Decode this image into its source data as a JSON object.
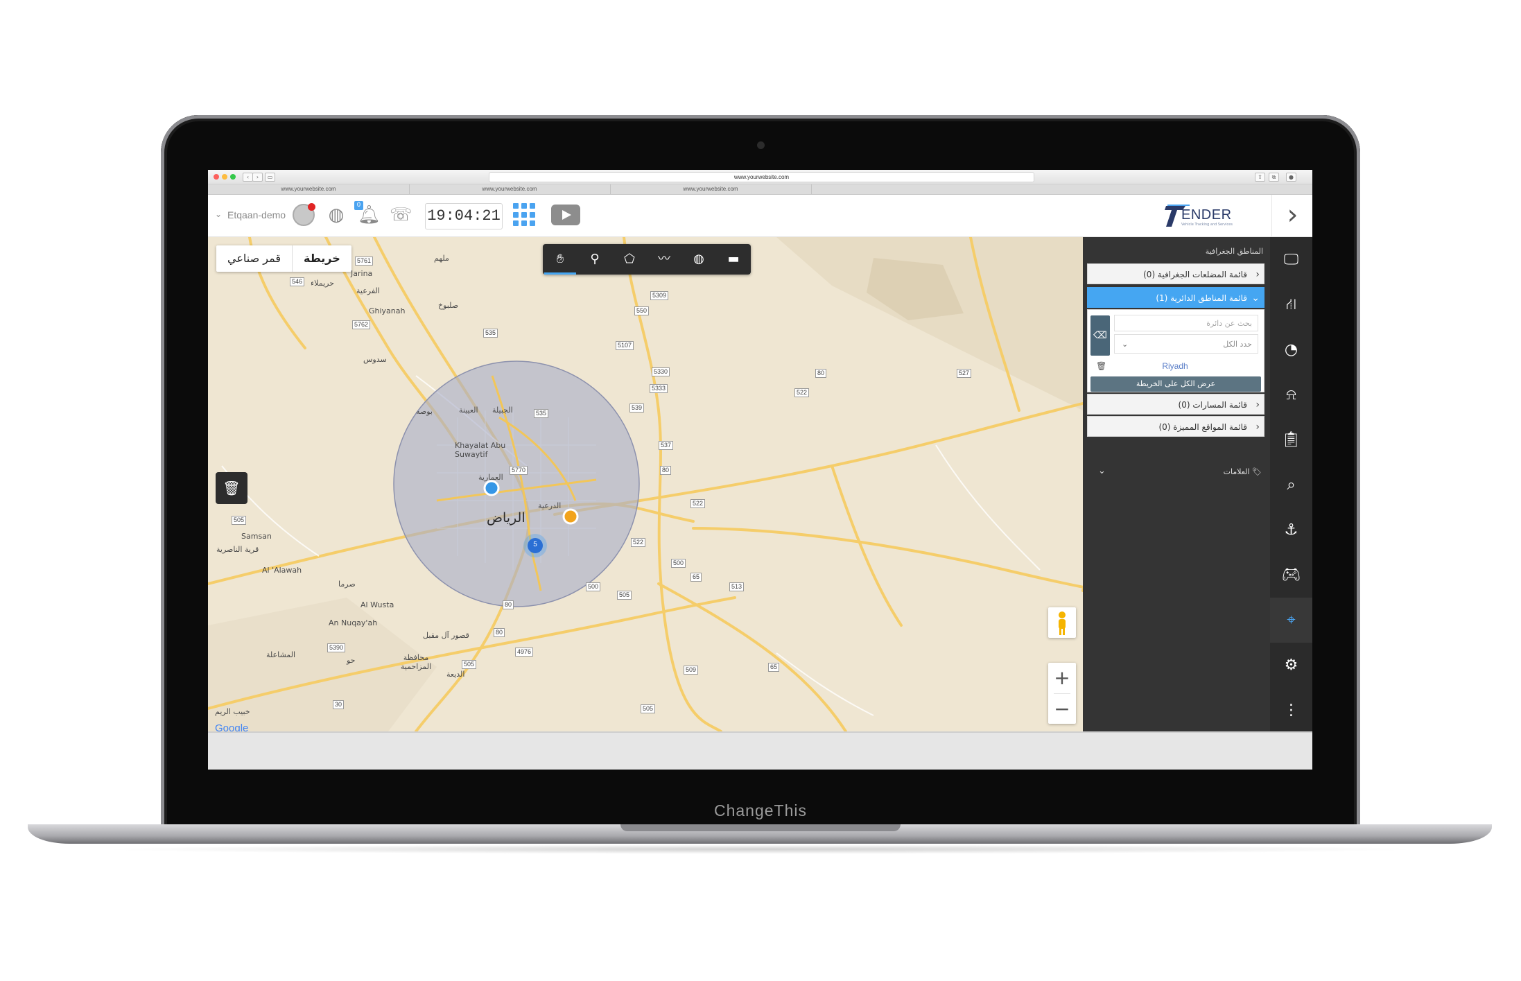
{
  "device": {
    "chin_label": "ChangeThis"
  },
  "browser": {
    "address": "www.yourwebsite.com",
    "tabs": [
      "www.yourwebsite.com",
      "www.yourwebsite.com",
      "www.yourwebsite.com"
    ]
  },
  "header": {
    "user": "Etqaan-demo",
    "notification_count": "0",
    "clock": "19:04:21",
    "logo_text": "ENDER",
    "logo_sub": "Vehicle Tracking and Services"
  },
  "map": {
    "type_options": {
      "map": "خريطة",
      "satellite": "قمر صناعي"
    },
    "cluster_count": "5",
    "city_label": "الرياض",
    "labels": [
      "ملهم",
      "Jarina",
      "حريملاء",
      "الفرعية",
      "Ghiyanah",
      "صلبوخ",
      "سدوس",
      "بوصه",
      "العيينة",
      "الجبيلة",
      "Khayalat Abu Suwaytif",
      "العمارية",
      "الدرعية",
      "Samsan",
      "قرية الناصرية",
      "Al 'Alawah",
      "صرما",
      "Al Wusta",
      "An Nuqay'ah",
      "قصور آل مقبل",
      "المشاعلة",
      "محافظة المزاحمية",
      "الديعة",
      "حو",
      "خبيب الريم"
    ],
    "road_numbers": [
      "5761",
      "546",
      "5762",
      "535",
      "5309",
      "550",
      "5107",
      "5330",
      "5333",
      "539",
      "535",
      "80",
      "522",
      "5770",
      "537",
      "80",
      "522",
      "505",
      "522",
      "500",
      "65",
      "513",
      "500",
      "505",
      "80",
      "5390",
      "4976",
      "505",
      "509",
      "65",
      "30",
      "505",
      "527",
      "80"
    ],
    "google": "Google"
  },
  "panel": {
    "title": "المناطق الجغرافية",
    "polygons": "قائمة المضلعات الجغرافية (0)",
    "circles": "قائمة المناطق الدائرية (1)",
    "circle_search_placeholder": "بحث عن دائرة",
    "select_all": "حدد الكل",
    "zone_name": "Riyadh",
    "show_all_button": "عرض الكل على الخريطة",
    "routes": "قائمة المسارات (0)",
    "featured": "قائمة المواقع المميزة (0)",
    "markers": "العلامات"
  },
  "colors": {
    "accent": "#45a6f2",
    "sidebar": "#2b2b2b",
    "panel": "#343434",
    "circle_fill": "#a9aec8"
  }
}
